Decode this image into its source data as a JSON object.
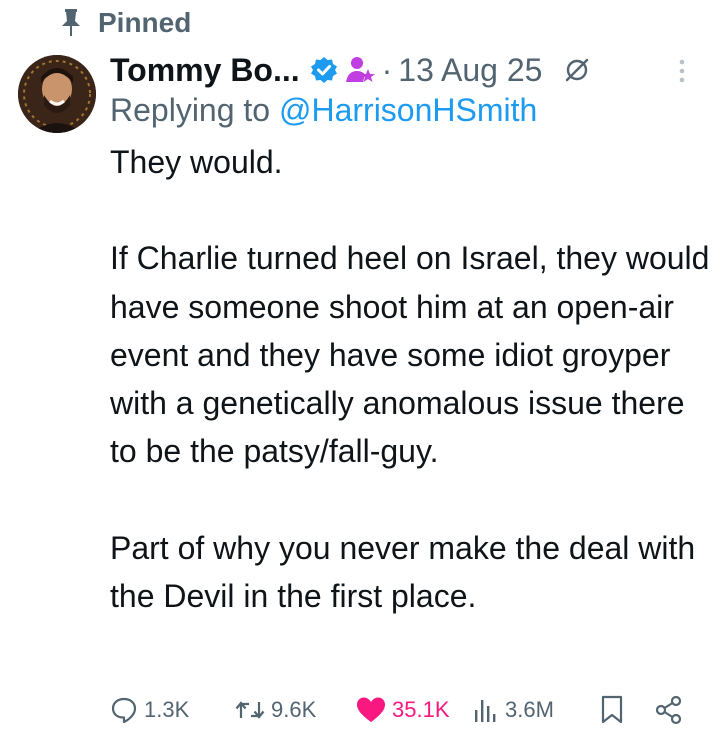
{
  "pinned": {
    "label": "Pinned",
    "icon": "pin-icon"
  },
  "author": {
    "name": "Tommy Bo...",
    "verified": true,
    "verified_color": "#1d9bf0",
    "affiliate_icon": "person-star-icon",
    "affiliate_color": "#c13ee0",
    "timestamp": "13 Aug 25"
  },
  "reply": {
    "prefix": "Replying to ",
    "handle": "@HarrisonHSmith"
  },
  "tweet": {
    "text": "They would.\n\nIf Charlie turned heel on Israel, they would have someone shoot him at an open-air event and they have some idiot groyper with a genetically anomalous issue there to be the patsy/fall-guy.\n\nPart of why you never make the deal with the Devil in the first place."
  },
  "actions": {
    "replies": "1.3K",
    "reposts": "9.6K",
    "likes": "35.1K",
    "views": "3.6M"
  },
  "colors": {
    "text": "#0f1419",
    "secondary": "#536471",
    "link": "#1d9bf0",
    "like": "#f91880"
  }
}
